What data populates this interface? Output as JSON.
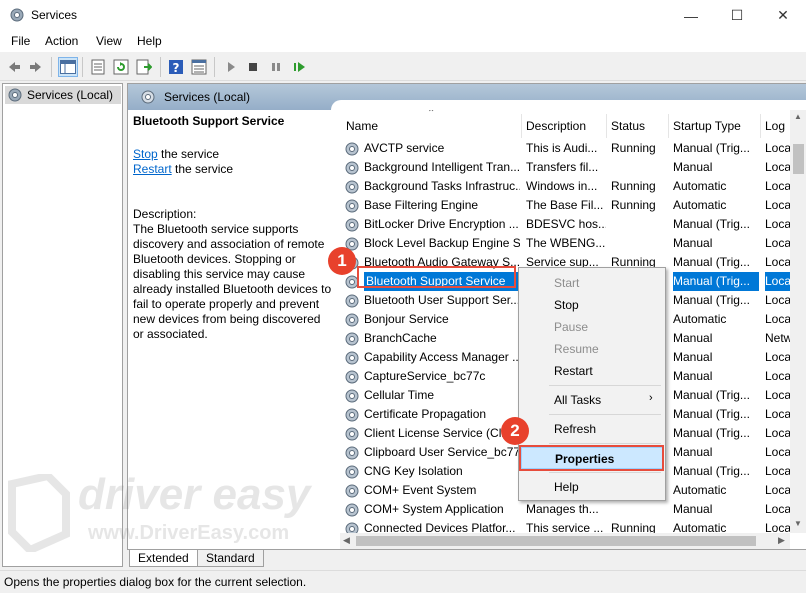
{
  "window": {
    "title": "Services"
  },
  "menu": [
    "File",
    "Action",
    "View",
    "Help"
  ],
  "tree": {
    "item": "Services (Local)"
  },
  "header": {
    "title": "Services (Local)"
  },
  "description": {
    "service_name": "Bluetooth Support Service",
    "stop_link": "Stop",
    "stop_suffix": " the service",
    "restart_link": "Restart",
    "restart_suffix": " the service",
    "label": "Description:",
    "lines": [
      "The Bluetooth service supports",
      "discovery and association of remote",
      "Bluetooth devices.  Stopping or",
      "disabling this service may cause",
      "already installed Bluetooth devices to",
      "fail to operate properly and prevent",
      "new devices from being discovered",
      "or associated."
    ]
  },
  "columns": [
    "Name",
    "Description",
    "Status",
    "Startup Type",
    "Log"
  ],
  "rows": [
    {
      "name": "AVCTP service",
      "desc": "This is Audi...",
      "status": "Running",
      "startup": "Manual (Trig...",
      "log": "Loca"
    },
    {
      "name": "Background Intelligent Tran...",
      "desc": "Transfers fil...",
      "status": "",
      "startup": "Manual",
      "log": "Loca"
    },
    {
      "name": "Background Tasks Infrastruc...",
      "desc": "Windows in...",
      "status": "Running",
      "startup": "Automatic",
      "log": "Loca"
    },
    {
      "name": "Base Filtering Engine",
      "desc": "The Base Fil...",
      "status": "Running",
      "startup": "Automatic",
      "log": "Loca"
    },
    {
      "name": "BitLocker Drive Encryption ...",
      "desc": "BDESVC hos...",
      "status": "",
      "startup": "Manual (Trig...",
      "log": "Loca"
    },
    {
      "name": "Block Level Backup Engine S...",
      "desc": "The WBENG...",
      "status": "",
      "startup": "Manual",
      "log": "Loca"
    },
    {
      "name": "Bluetooth Audio Gateway S...",
      "desc": "Service sup...",
      "status": "Running",
      "startup": "Manual (Trig...",
      "log": "Loca"
    },
    {
      "name": "Bluetooth Support Service",
      "desc": "",
      "status": "",
      "startup": "Manual (Trig...",
      "log": "Loca"
    },
    {
      "name": "Bluetooth User Support Ser...",
      "desc": "",
      "status": "",
      "startup": "Manual (Trig...",
      "log": "Loca"
    },
    {
      "name": "Bonjour Service",
      "desc": "",
      "status": "",
      "startup": "Automatic",
      "log": "Loca"
    },
    {
      "name": "BranchCache",
      "desc": "",
      "status": "",
      "startup": "Manual",
      "log": "Netw"
    },
    {
      "name": "Capability Access Manager ...",
      "desc": "",
      "status": "",
      "startup": "Manual",
      "log": "Loca"
    },
    {
      "name": "CaptureService_bc77c",
      "desc": "",
      "status": "",
      "startup": "Manual",
      "log": "Loca"
    },
    {
      "name": "Cellular Time",
      "desc": "",
      "status": "",
      "startup": "Manual (Trig...",
      "log": "Loca"
    },
    {
      "name": "Certificate Propagation",
      "desc": "",
      "status": "",
      "startup": "Manual (Trig...",
      "log": "Loca"
    },
    {
      "name": "Client License Service (Clip",
      "desc": "",
      "status": "",
      "startup": "Manual (Trig...",
      "log": "Loca"
    },
    {
      "name": "Clipboard User Service_bc77c",
      "desc": "",
      "status": "",
      "startup": "Manual",
      "log": "Loca"
    },
    {
      "name": "CNG Key Isolation",
      "desc": "",
      "status": "",
      "startup": "Manual (Trig...",
      "log": "Loca"
    },
    {
      "name": "COM+ Event System",
      "desc": "",
      "status": "",
      "startup": "Automatic",
      "log": "Loca"
    },
    {
      "name": "COM+ System Application",
      "desc": "Manages th...",
      "status": "",
      "startup": "Manual",
      "log": "Loca"
    },
    {
      "name": "Connected Devices Platfor...",
      "desc": "This service ...",
      "status": "Running",
      "startup": "Automatic",
      "log": "Loca"
    }
  ],
  "context_menu": {
    "start": "Start",
    "stop": "Stop",
    "pause": "Pause",
    "resume": "Resume",
    "restart": "Restart",
    "all_tasks": "All Tasks",
    "refresh": "Refresh",
    "properties": "Properties",
    "help": "Help"
  },
  "tabs": [
    "Extended",
    "Standard"
  ],
  "status_bar": "Opens the properties dialog box for the current selection.",
  "annotations": {
    "step1": "1",
    "step2": "2"
  },
  "watermark": {
    "brand": "driver easy",
    "url": "www.DriverEasy.com"
  },
  "colors": {
    "selection": "#0078d7",
    "annotation_red": "#e74c3c",
    "link": "#0066cc"
  }
}
